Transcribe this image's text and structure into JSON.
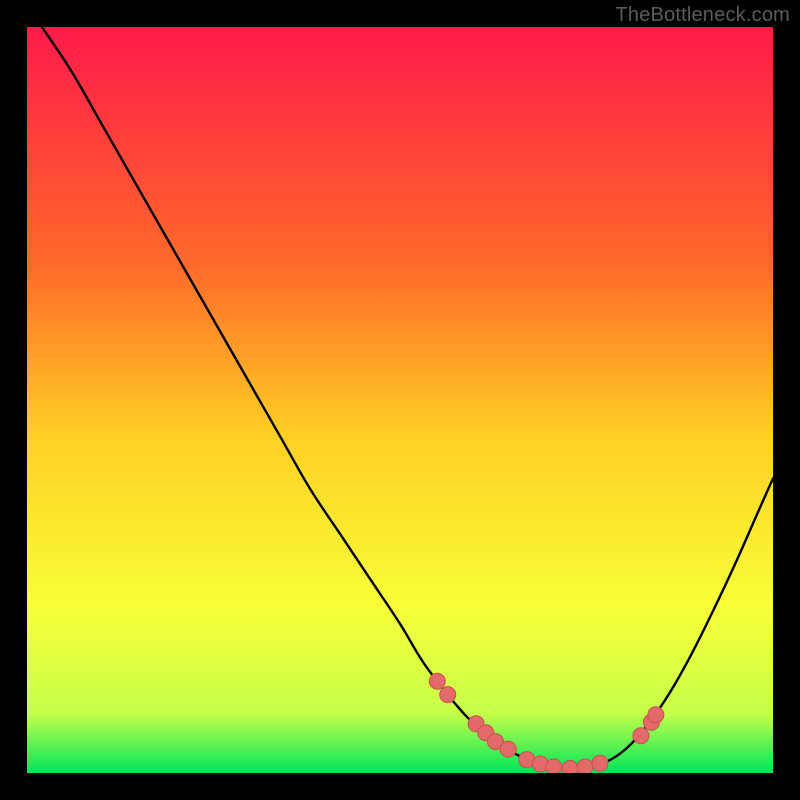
{
  "attribution": "TheBottleneck.com",
  "colors": {
    "gradient_top": "#ff1a4a",
    "gradient_mid_upper": "#ff6a2a",
    "gradient_mid": "#ffd024",
    "gradient_mid_lower": "#f8ff38",
    "gradient_lower": "#c6ff4a",
    "gradient_bottom": "#00e559",
    "curve": "#000000",
    "dots": "#e46a6a",
    "dot_stroke": "#c94f50"
  },
  "chart_data": {
    "type": "line",
    "title": "",
    "xlabel": "",
    "ylabel": "",
    "xlim": [
      0,
      100
    ],
    "ylim": [
      0,
      100
    ],
    "curve": {
      "name": "bottleneck-curve",
      "x": [
        2,
        6,
        10,
        14,
        18,
        22,
        26,
        30,
        34,
        38,
        42,
        46,
        50,
        53,
        56,
        59,
        62,
        65,
        68,
        71,
        74,
        77,
        80,
        83,
        86,
        89,
        92,
        95,
        98,
        100
      ],
      "y": [
        100,
        94,
        87,
        80,
        73,
        66,
        59,
        52,
        45,
        38,
        32,
        26,
        20,
        15,
        11,
        7.5,
        4.8,
        2.8,
        1.5,
        0.8,
        0.6,
        1.2,
        3.0,
        6.2,
        10.5,
        15.8,
        21.8,
        28.2,
        35.0,
        39.5
      ]
    },
    "dots": {
      "name": "highlight-dots",
      "points": [
        {
          "x": 55.0,
          "y": 12.3
        },
        {
          "x": 56.4,
          "y": 10.5
        },
        {
          "x": 60.2,
          "y": 6.6
        },
        {
          "x": 61.5,
          "y": 5.4
        },
        {
          "x": 62.8,
          "y": 4.2
        },
        {
          "x": 64.5,
          "y": 3.2
        },
        {
          "x": 67.0,
          "y": 1.8
        },
        {
          "x": 68.8,
          "y": 1.2
        },
        {
          "x": 70.6,
          "y": 0.8
        },
        {
          "x": 72.8,
          "y": 0.6
        },
        {
          "x": 74.8,
          "y": 0.8
        },
        {
          "x": 76.8,
          "y": 1.3
        },
        {
          "x": 82.3,
          "y": 5.0
        },
        {
          "x": 83.7,
          "y": 6.8
        },
        {
          "x": 84.3,
          "y": 7.8
        }
      ]
    }
  }
}
